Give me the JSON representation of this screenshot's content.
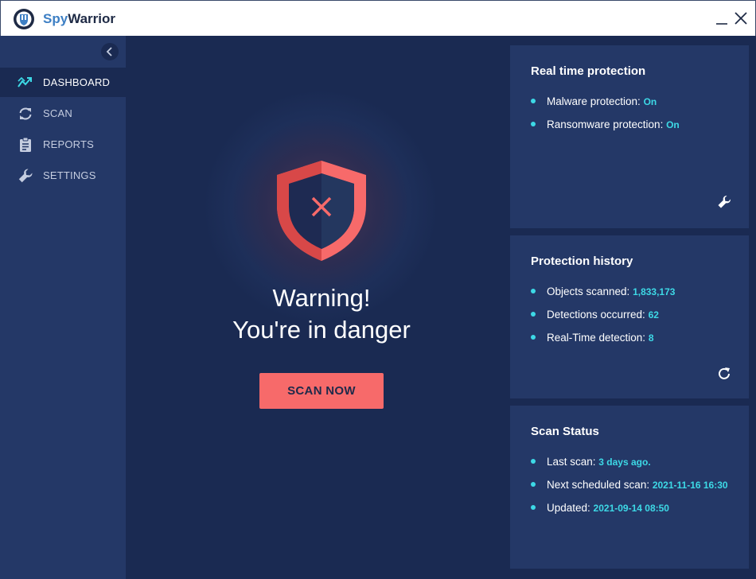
{
  "app": {
    "title_part1": "Spy",
    "title_part2": "Warrior"
  },
  "sidebar": {
    "items": [
      {
        "label": "DASHBOARD",
        "icon": "chart-trend-icon",
        "active": true
      },
      {
        "label": "SCAN",
        "icon": "refresh-icon"
      },
      {
        "label": "REPORTS",
        "icon": "clipboard-icon"
      },
      {
        "label": "SETTINGS",
        "icon": "wrench-icon"
      }
    ]
  },
  "main": {
    "warning_title": "Warning!",
    "warning_subtitle": "You're in danger",
    "scan_button": "SCAN NOW"
  },
  "realtime": {
    "title": "Real time protection",
    "rows": [
      {
        "label": "Malware protection: ",
        "value": "On"
      },
      {
        "label": "Ransomware protection: ",
        "value": "On"
      }
    ]
  },
  "history": {
    "title": "Protection history",
    "rows": [
      {
        "label": "Objects scanned: ",
        "value": "1,833,173"
      },
      {
        "label": "Detections occurred: ",
        "value": "62"
      },
      {
        "label": "Real-Time detection: ",
        "value": "8"
      }
    ]
  },
  "scan_status": {
    "title": "Scan Status",
    "rows": [
      {
        "label": "Last scan: ",
        "value": "3 days ago."
      },
      {
        "label": "Next scheduled scan: ",
        "value": "2021-11-16 16:30"
      },
      {
        "label": "Updated: ",
        "value": "2021-09-14 08:50"
      }
    ]
  },
  "colors": {
    "accent": "#3dd9e6",
    "danger": "#f76a6a",
    "panel": "#243867",
    "background": "#1a2a52"
  }
}
